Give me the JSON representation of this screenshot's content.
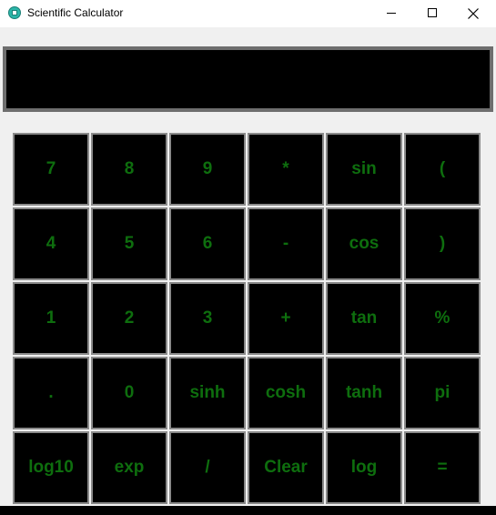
{
  "window": {
    "title": "Scientific Calculator",
    "icon": "calculator-icon"
  },
  "display": {
    "value": ""
  },
  "keypad": {
    "rows": [
      [
        "7",
        "8",
        "9",
        "*",
        "sin",
        "("
      ],
      [
        "4",
        "5",
        "6",
        "-",
        "cos",
        ")"
      ],
      [
        "1",
        "2",
        "3",
        "+",
        "tan",
        "%"
      ],
      [
        ".",
        "0",
        "sinh",
        "cosh",
        "tanh",
        "pi"
      ],
      [
        "log10",
        "exp",
        "/",
        "Clear",
        "log",
        "="
      ]
    ]
  },
  "colors": {
    "key_background": "#000000",
    "key_text": "#0e6e0e",
    "key_border": "#8a8a8a",
    "display_background": "#000000",
    "display_border": "#6e6e6e",
    "window_background": "#f0f0f0"
  }
}
